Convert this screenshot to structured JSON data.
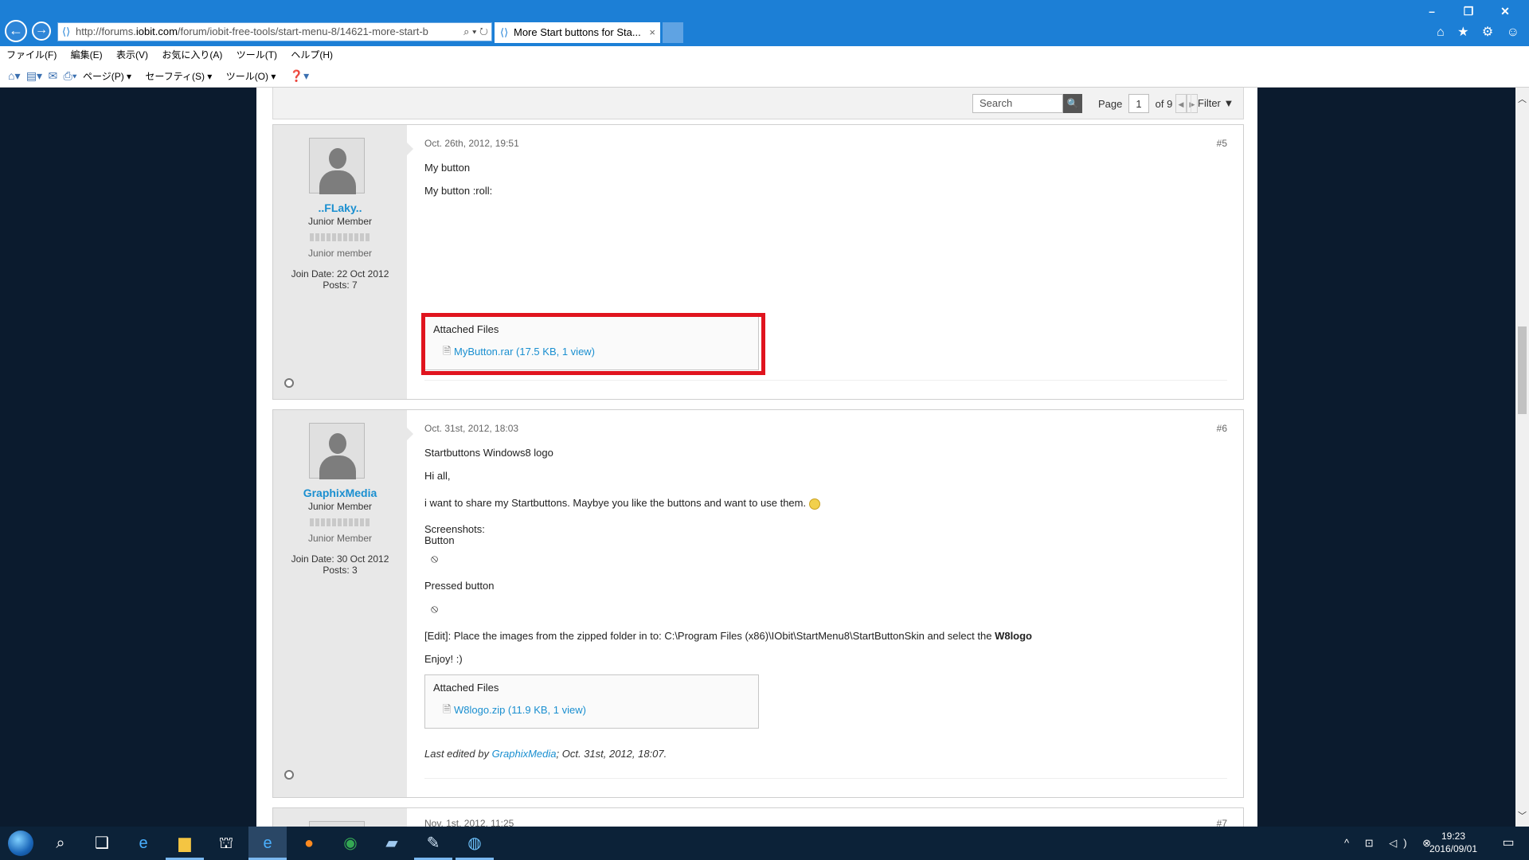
{
  "browser": {
    "url_prefix": "http://forums.",
    "url_host": "iobit.com",
    "url_rest": "/forum/iobit-free-tools/start-menu-8/14621-more-start-b",
    "tab_title": "More Start buttons for Sta...",
    "tab_close": "×",
    "back_glyph": "←",
    "fwd_glyph": "→",
    "addr_icon": "⟨⟩",
    "addr_tools": "⌕ ▾ ↻",
    "win_min": "–",
    "win_max": "❐",
    "win_close": "✕",
    "right_icons": "⌂ ★ ⚙ ☺"
  },
  "menu": [
    "ファイル(F)",
    "編集(E)",
    "表示(V)",
    "お気に入り(A)",
    "ツール(T)",
    "ヘルプ(H)"
  ],
  "commands": {
    "page": "ページ(P) ▾",
    "safety": "セーフティ(S) ▾",
    "tools": "ツール(O) ▾",
    "help": "❓▾"
  },
  "toolbar": {
    "search_placeholder": "Search",
    "search_icon": "🔍",
    "page_label": "Page",
    "page_current": "1",
    "page_of": "of 9",
    "prev": "◀",
    "next": "▶",
    "filter": "Filter ▼"
  },
  "posts": [
    {
      "date": "Oct. 26th, 2012, 19:51",
      "number": "#5",
      "user": "..FLaky..",
      "rank": "Junior Member",
      "rank2": "Junior member",
      "join": "Join Date: 22 Oct 2012",
      "posts": "Posts: 7",
      "title": "My button",
      "body": "My button :roll:",
      "attach_title": "Attached Files",
      "attach_link": "MyButton.rar (17.5 KB, 1 view)"
    },
    {
      "date": "Oct. 31st, 2012, 18:03",
      "number": "#6",
      "user": "GraphixMedia",
      "rank": "Junior Member",
      "rank2": "Junior Member",
      "join": "Join Date: 30 Oct 2012",
      "posts": "Posts: 3",
      "title": "Startbuttons Windows8 logo",
      "greeting": "Hi all,",
      "share": "i want to share my Startbuttons. Maybye you like the buttons and want to use them.",
      "screenshots": "Screenshots:",
      "button_lbl": "Button",
      "pressed_lbl": "Pressed button",
      "edit_pre": "[Edit]: Place the images from the zipped folder in to: C:\\Program Files (x86)\\IObit\\StartMenu8\\StartButtonSkin and select the ",
      "edit_bold": "W8logo",
      "enjoy": "Enjoy! :)",
      "attach_title": "Attached Files",
      "attach_link": "W8logo.zip (11.9 KB, 1 view)",
      "edited_pre": "Last edited by ",
      "edited_user": "GraphixMedia",
      "edited_post": "; Oct. 31st, 2012, 18:07."
    },
    {
      "date": "Nov. 1st, 2012, 11:25",
      "number": "#7"
    }
  ],
  "taskbar": {
    "time": "19:23",
    "date": "2016/09/01",
    "tray": "^ ⊡ ◁) ⊗"
  }
}
